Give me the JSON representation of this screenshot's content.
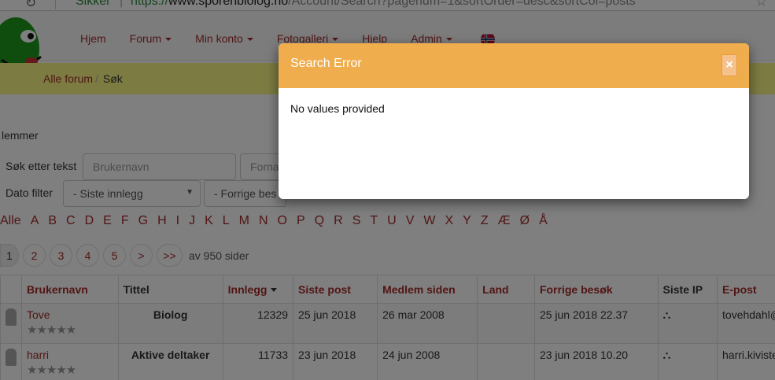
{
  "browser": {
    "secure_label": "Sikker",
    "url_scheme": "https://",
    "url_host": "www.sporenbiolog.no",
    "url_path": "/Account/Search?pagenum=1&sortOrder=desc&sortCol=posts"
  },
  "nav": {
    "items": [
      {
        "label": "Hjem",
        "dropdown": false
      },
      {
        "label": "Forum",
        "dropdown": true
      },
      {
        "label": "Min konto",
        "dropdown": true
      },
      {
        "label": "Fotogalleri",
        "dropdown": true
      },
      {
        "label": "Hjelp",
        "dropdown": false
      },
      {
        "label": "Admin",
        "dropdown": true
      }
    ]
  },
  "breadcrumb": {
    "parent": "Alle forum",
    "current": "Søk"
  },
  "section_label": "lemmer",
  "search": {
    "text_label": "Søk etter tekst",
    "username_placeholder": "Brukernavn",
    "firstname_placeholder": "Forna",
    "date_label": "Dato filter",
    "date_select_value": "- Siste innlegg",
    "prev_visit_value": "- Forrige bes"
  },
  "alphabet": [
    "Alle",
    "A",
    "B",
    "C",
    "D",
    "E",
    "F",
    "G",
    "H",
    "I",
    "J",
    "K",
    "L",
    "M",
    "N",
    "O",
    "P",
    "Q",
    "R",
    "S",
    "T",
    "U",
    "V",
    "W",
    "X",
    "Y",
    "Z",
    "Æ",
    "Ø",
    "Å"
  ],
  "pagination": {
    "pages": [
      "1",
      "2",
      "3",
      "4",
      "5"
    ],
    "next": ">",
    "last": ">>",
    "info": "av 950 sider",
    "current": "1"
  },
  "table": {
    "headers": {
      "username": "Brukernavn",
      "title": "Tittel",
      "posts": "Innlegg",
      "last_post": "Siste post",
      "member_since": "Medlem siden",
      "country": "Land",
      "prev_visit": "Forrige besøk",
      "last_ip": "Siste IP",
      "email": "E-post"
    },
    "rows": [
      {
        "username": "Tove",
        "title": "Biolog",
        "posts": "12329",
        "last_post": "25 jun 2018",
        "member_since": "26 mar 2008",
        "country": "",
        "prev_visit": "25 jun 2018 22.37",
        "email": "tovehdahl@"
      },
      {
        "username": "harri",
        "title": "Aktive deltaker",
        "posts": "11733",
        "last_post": "23 jun 2018",
        "member_since": "24 jun 2008",
        "country": "",
        "prev_visit": "23 jun 2018 10.20",
        "email": "harri.kiviste"
      }
    ]
  },
  "modal": {
    "title": "Search Error",
    "close_label": "×",
    "message": "No values provided"
  },
  "colors": {
    "link": "#a52a2a",
    "modal_header": "#f0ad4e",
    "breadcrumb_bg": "#f7f784"
  }
}
